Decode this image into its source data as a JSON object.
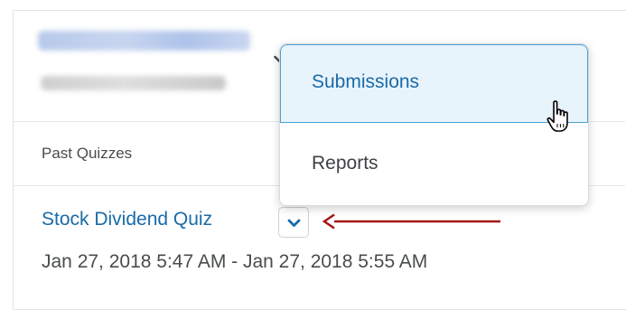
{
  "header": {
    "section_title": "Past Quizzes"
  },
  "quiz": {
    "title": "Stock Dividend Quiz",
    "dates": "Jan 27, 2018 5:47 AM - Jan 27, 2018 5:55 AM"
  },
  "context_menu": {
    "items": [
      {
        "label": "Submissions",
        "state": "hover"
      },
      {
        "label": "Reports"
      }
    ]
  },
  "colors": {
    "link": "#1a6aa8",
    "text": "#494c4e",
    "highlight_bg": "#e8f4fb",
    "highlight_border": "#4ea0d8",
    "annotation_arrow": "#a31515"
  },
  "icons": {
    "dropdown": "chevron-down-icon",
    "pointer": "hand-cursor-icon",
    "annotation": "red-arrow-icon"
  }
}
